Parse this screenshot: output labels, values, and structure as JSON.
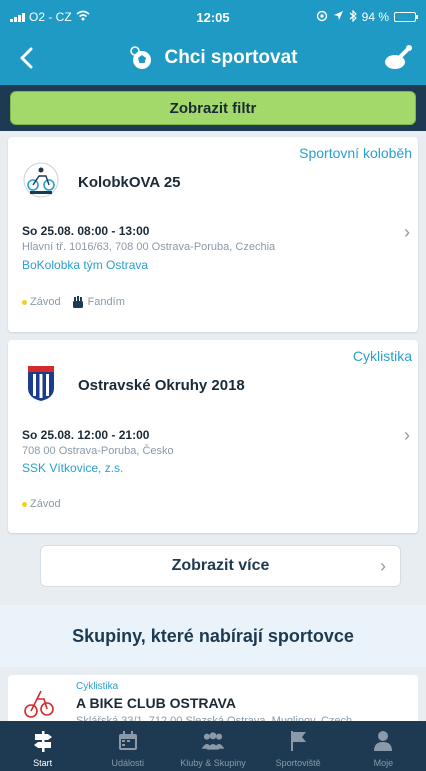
{
  "status": {
    "carrier": "O2 - CZ",
    "time": "12:05",
    "battery": "94 %"
  },
  "header": {
    "title": "Chci sportovat"
  },
  "filter": {
    "label": "Zobrazit filtr"
  },
  "events": [
    {
      "category": "Sportovní koloběh",
      "title": "KolobkOVA 25",
      "date": "So 25.08. 08:00 - 13:00",
      "address": "Hlavní tř. 1016/63, 708 00 Ostrava-Poruba, Czechia",
      "organizer": "BoKolobka tým Ostrava",
      "tags": [
        "Závod",
        "Fandím"
      ]
    },
    {
      "category": "Cyklistika",
      "title": "Ostravské Okruhy 2018",
      "date": "So 25.08. 12:00 - 21:00",
      "address": "708 00 Ostrava-Poruba, Česko",
      "organizer": "SSK Vítkovice, z.s.",
      "tags": [
        "Závod"
      ]
    }
  ],
  "more": {
    "label": "Zobrazit více"
  },
  "groups_section": {
    "title": "Skupiny, které nabírají sportovce"
  },
  "groups": [
    {
      "category": "Cyklistika",
      "name": "A BIKE CLUB OSTRAVA",
      "address": "Sklářská 33/1, 712 00 Slezská Ostrava, Muglinov, Czech"
    }
  ],
  "tabbar": [
    {
      "label": "Start",
      "icon": "signpost-icon",
      "active": true
    },
    {
      "label": "Události",
      "icon": "calendar-icon",
      "active": false
    },
    {
      "label": "Kluby & Skupiny",
      "icon": "people-icon",
      "active": false
    },
    {
      "label": "Sportoviště",
      "icon": "flag-icon",
      "active": false
    },
    {
      "label": "Moje",
      "icon": "person-icon",
      "active": false
    }
  ],
  "colors": {
    "header": "#1e9ac4",
    "dark": "#1e3a52",
    "accent_green": "#a3d86a",
    "link": "#2aa0cc",
    "tag_dot": "#f2d022"
  }
}
